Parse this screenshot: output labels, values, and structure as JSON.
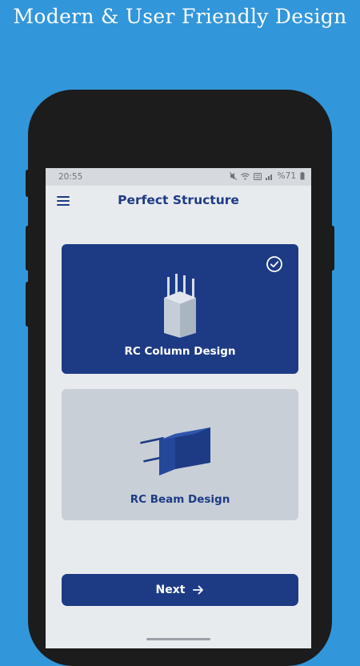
{
  "promo": {
    "headline": "Modern & User Friendly Design"
  },
  "status_bar": {
    "time": "20:55",
    "battery": "%71"
  },
  "app_bar": {
    "title": "Perfect Structure",
    "menu_icon": "hamburger-menu-icon"
  },
  "design_options": [
    {
      "label": "RC Column Design",
      "selected": true,
      "icon": "column-icon"
    },
    {
      "label": "RC Beam Design",
      "selected": false,
      "icon": "beam-icon"
    }
  ],
  "actions": {
    "next_label": "Next",
    "next_icon": "arrow-right-icon"
  },
  "colors": {
    "background": "#3296da",
    "primary": "#1d3b85",
    "screen": "#e8ebee",
    "card_unselected": "#c8cfd7"
  }
}
